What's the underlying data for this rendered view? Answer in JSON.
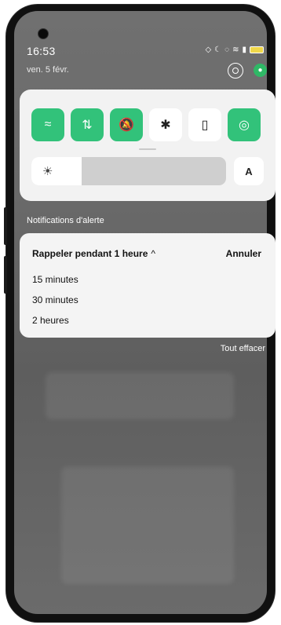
{
  "status_bar": {
    "time": "16:53",
    "date": "ven. 5 févr."
  },
  "quick_settings": {
    "tiles": [
      {
        "name": "wifi",
        "icon": "wifi-icon",
        "state": "on",
        "glyph": "≈"
      },
      {
        "name": "mobile-data",
        "icon": "mobile-data-icon",
        "state": "on",
        "glyph": "⇅"
      },
      {
        "name": "mute",
        "icon": "mute-bell-icon",
        "state": "on",
        "glyph": "🔕"
      },
      {
        "name": "bluetooth",
        "icon": "bluetooth-icon",
        "state": "off",
        "glyph": "✱"
      },
      {
        "name": "flashlight",
        "icon": "flashlight-icon",
        "state": "off",
        "glyph": "▯"
      },
      {
        "name": "hotspot",
        "icon": "location-icon",
        "state": "on",
        "glyph": "◎"
      }
    ],
    "brightness_level": 0.26,
    "auto_label": "A",
    "accent_color": "#32c27a"
  },
  "notifications": {
    "header": "Notifications d'alerte",
    "snooze": {
      "title": "Rappeler pendant 1 heure",
      "cancel_label": "Annuler",
      "options": [
        "15 minutes",
        "30 minutes",
        "2 heures"
      ]
    },
    "clear_all_label": "Tout effacer"
  }
}
